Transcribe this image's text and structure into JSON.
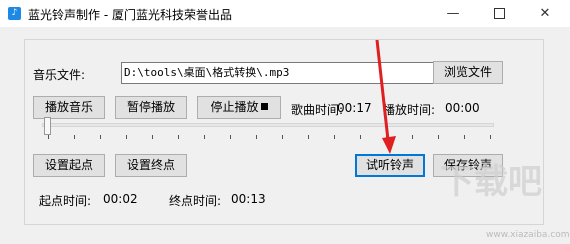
{
  "window": {
    "title": "蓝光铃声制作 - 厦门蓝光科技荣誉出品",
    "minimize_glyph": "—",
    "close_glyph": "✕"
  },
  "file_row": {
    "label": "音乐文件:",
    "path_value": "D:\\tools\\桌面\\格式转换\\.mp3",
    "browse_label": "浏览文件"
  },
  "playback": {
    "play_label": "播放音乐",
    "pause_label": "暂停播放",
    "stop_label": "停止播放",
    "song_time_label": "歌曲时间:",
    "song_time_value": "00:17",
    "play_time_label": "播放时间:",
    "play_time_value": "00:00"
  },
  "slider": {
    "position": 0
  },
  "marks": {
    "set_start_label": "设置起点",
    "set_end_label": "设置终点",
    "preview_label": "试听铃声",
    "save_label": "保存铃声"
  },
  "times": {
    "start_label": "起点时间:",
    "start_value": "00:02",
    "end_label": "终点时间:",
    "end_value": "00:13"
  },
  "watermark": {
    "text": "下载吧",
    "url": "www.xiazaiba.com"
  },
  "colors": {
    "annotation_arrow": "#e02020",
    "focus_border": "#0078d7"
  }
}
